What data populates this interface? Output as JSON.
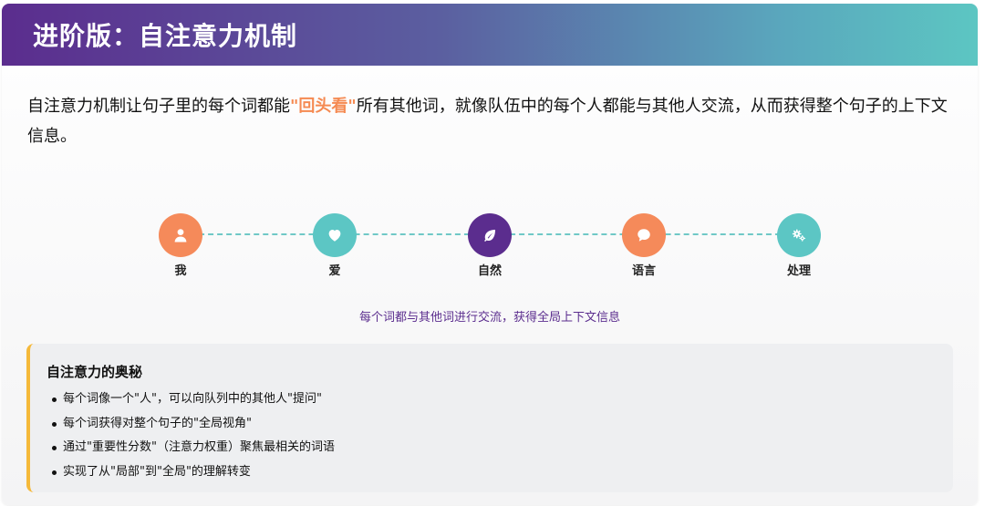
{
  "header": {
    "title": "进阶版：自注意力机制"
  },
  "intro": {
    "before": "自注意力机制让句子里的每个词都能",
    "highlight": "\"回头看\"",
    "after": "所有其他词，就像队伍中的每个人都能与其他人交流，从而获得整个句子的上下文信息。"
  },
  "flow": {
    "nodes": [
      {
        "label": "我",
        "icon": "user-icon",
        "color": "#f58a5a"
      },
      {
        "label": "爱",
        "icon": "heart-icon",
        "color": "#5cc6c4"
      },
      {
        "label": "自然",
        "icon": "leaf-icon",
        "color": "#5b2d8e"
      },
      {
        "label": "语言",
        "icon": "speech-bubble-icon",
        "color": "#f58a5a"
      },
      {
        "label": "处理",
        "icon": "gears-icon",
        "color": "#5cc6c4"
      }
    ],
    "caption": "每个词都与其他词进行交流，获得全局上下文信息"
  },
  "secret": {
    "title": "自注意力的奥秘",
    "items": [
      "每个词像一个\"人\"，可以向队列中的其他人\"提问\"",
      "每个词获得对整个句子的\"全局视角\"",
      "通过\"重要性分数\"（注意力权重）聚焦最相关的词语",
      "实现了从\"局部\"到\"全局\"的理解转变"
    ],
    "accent": "#f5b93a"
  }
}
